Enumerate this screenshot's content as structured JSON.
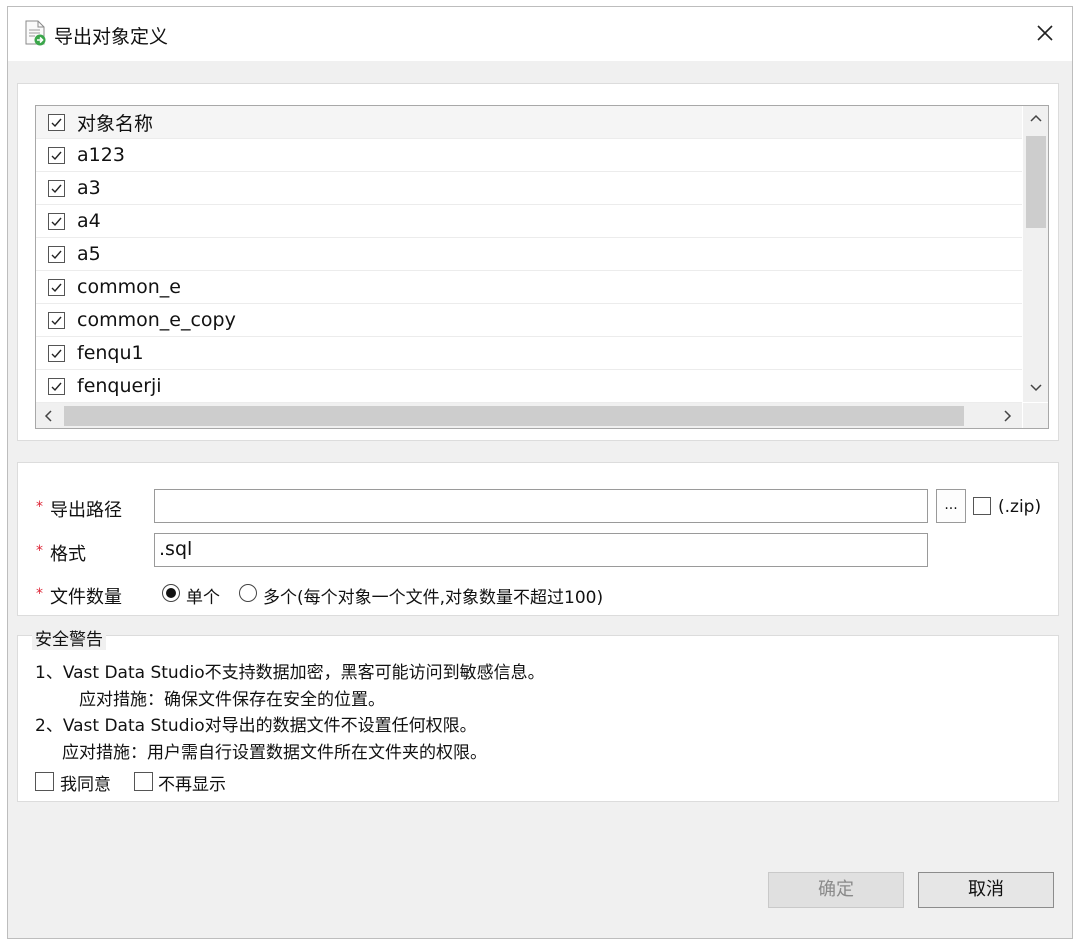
{
  "window": {
    "title": "导出对象定义"
  },
  "object_list": {
    "header": "对象名称",
    "items": [
      {
        "name": "a123",
        "checked": true
      },
      {
        "name": "a3",
        "checked": true
      },
      {
        "name": "a4",
        "checked": true
      },
      {
        "name": "a5",
        "checked": true
      },
      {
        "name": "common_e",
        "checked": true
      },
      {
        "name": "common_e_copy",
        "checked": true
      },
      {
        "name": "fenqu1",
        "checked": true
      },
      {
        "name": "fenquerji",
        "checked": true
      }
    ]
  },
  "form": {
    "required_mark": "*",
    "export_path_label": "导出路径",
    "export_path_value": "",
    "browse_label": "...",
    "zip_label": "(.zip)",
    "format_label": "格式",
    "format_value": ".sql",
    "file_count_label": "文件数量",
    "single_label": "单个",
    "multi_label": "多个(每个对象一个文件,对象数量不超过100)",
    "selected": "single"
  },
  "warning": {
    "title": "安全警告",
    "line1": "1、Vast Data Studio不支持数据加密，黑客可能访问到敏感信息。",
    "line2": "应对措施：确保文件保存在安全的位置。",
    "line3": "2、Vast Data Studio对导出的数据文件不设置任何权限。",
    "line4": "应对措施：用户需自行设置数据文件所在文件夹的权限。",
    "agree_label": "我同意",
    "no_show_label": "不再显示"
  },
  "buttons": {
    "ok": "确定",
    "cancel": "取消"
  },
  "colors": {
    "required": "#dd2233",
    "disabled_text": "#8a8a8a"
  }
}
